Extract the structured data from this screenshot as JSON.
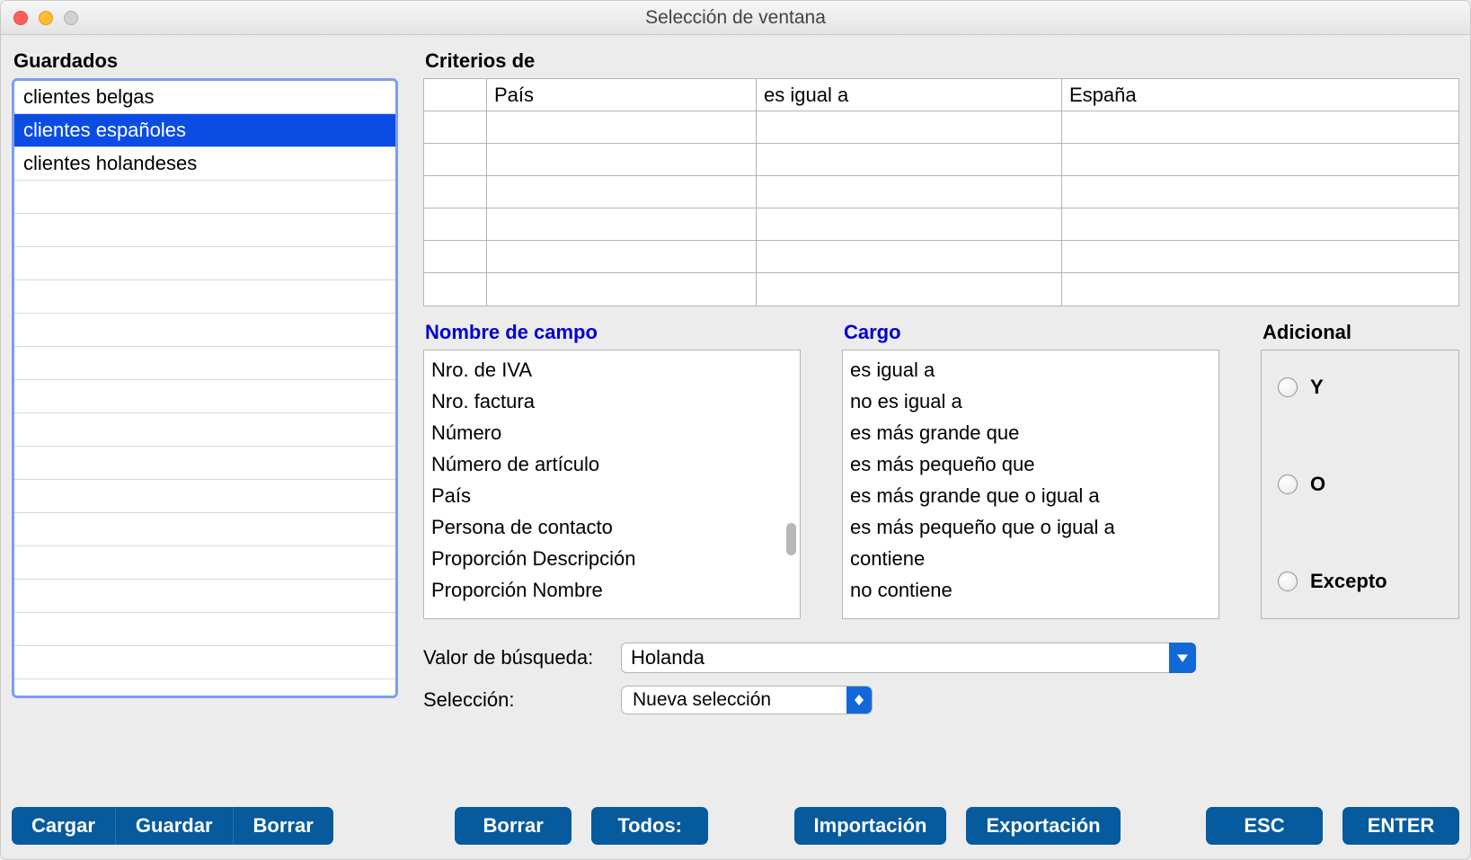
{
  "window": {
    "title": "Selección de ventana"
  },
  "saved": {
    "label": "Guardados",
    "items": [
      {
        "label": "clientes belgas",
        "selected": false
      },
      {
        "label": "clientes españoles",
        "selected": true
      },
      {
        "label": "clientes holandeses",
        "selected": false
      }
    ],
    "total_rows": 18
  },
  "criteria": {
    "label": "Criterios de",
    "rows": [
      {
        "op": "",
        "field": "País",
        "cond": "es igual a",
        "value": "España"
      },
      {
        "op": "",
        "field": "",
        "cond": "",
        "value": ""
      },
      {
        "op": "",
        "field": "",
        "cond": "",
        "value": ""
      },
      {
        "op": "",
        "field": "",
        "cond": "",
        "value": ""
      },
      {
        "op": "",
        "field": "",
        "cond": "",
        "value": ""
      },
      {
        "op": "",
        "field": "",
        "cond": "",
        "value": ""
      },
      {
        "op": "",
        "field": "",
        "cond": "",
        "value": ""
      }
    ]
  },
  "fields": {
    "label": "Nombre de campo",
    "items": [
      "Nro. de IVA",
      "Nro. factura",
      "Número",
      "Número de artículo",
      "País",
      "Persona de contacto",
      "Proporción Descripción",
      "Proporción Nombre"
    ]
  },
  "cargo": {
    "label": "Cargo",
    "items": [
      "es igual a",
      "no es igual a",
      "es más grande que",
      "es más pequeño que",
      "es más grande que o igual a",
      "es más pequeño que o igual a",
      "contiene",
      "no contiene"
    ]
  },
  "additional": {
    "label": "Adicional",
    "options": {
      "y": "Y",
      "o": "O",
      "excepto": "Excepto"
    }
  },
  "search": {
    "label": "Valor de búsqueda:",
    "value": "Holanda"
  },
  "selection": {
    "label": "Selección:",
    "value": "Nueva selección"
  },
  "buttons": {
    "cargar": "Cargar",
    "guardar": "Guardar",
    "borrar_left": "Borrar",
    "borrar": "Borrar",
    "todos": "Todos:",
    "import": "Importación",
    "export": "Exportación",
    "esc": "ESC",
    "enter": "ENTER"
  }
}
